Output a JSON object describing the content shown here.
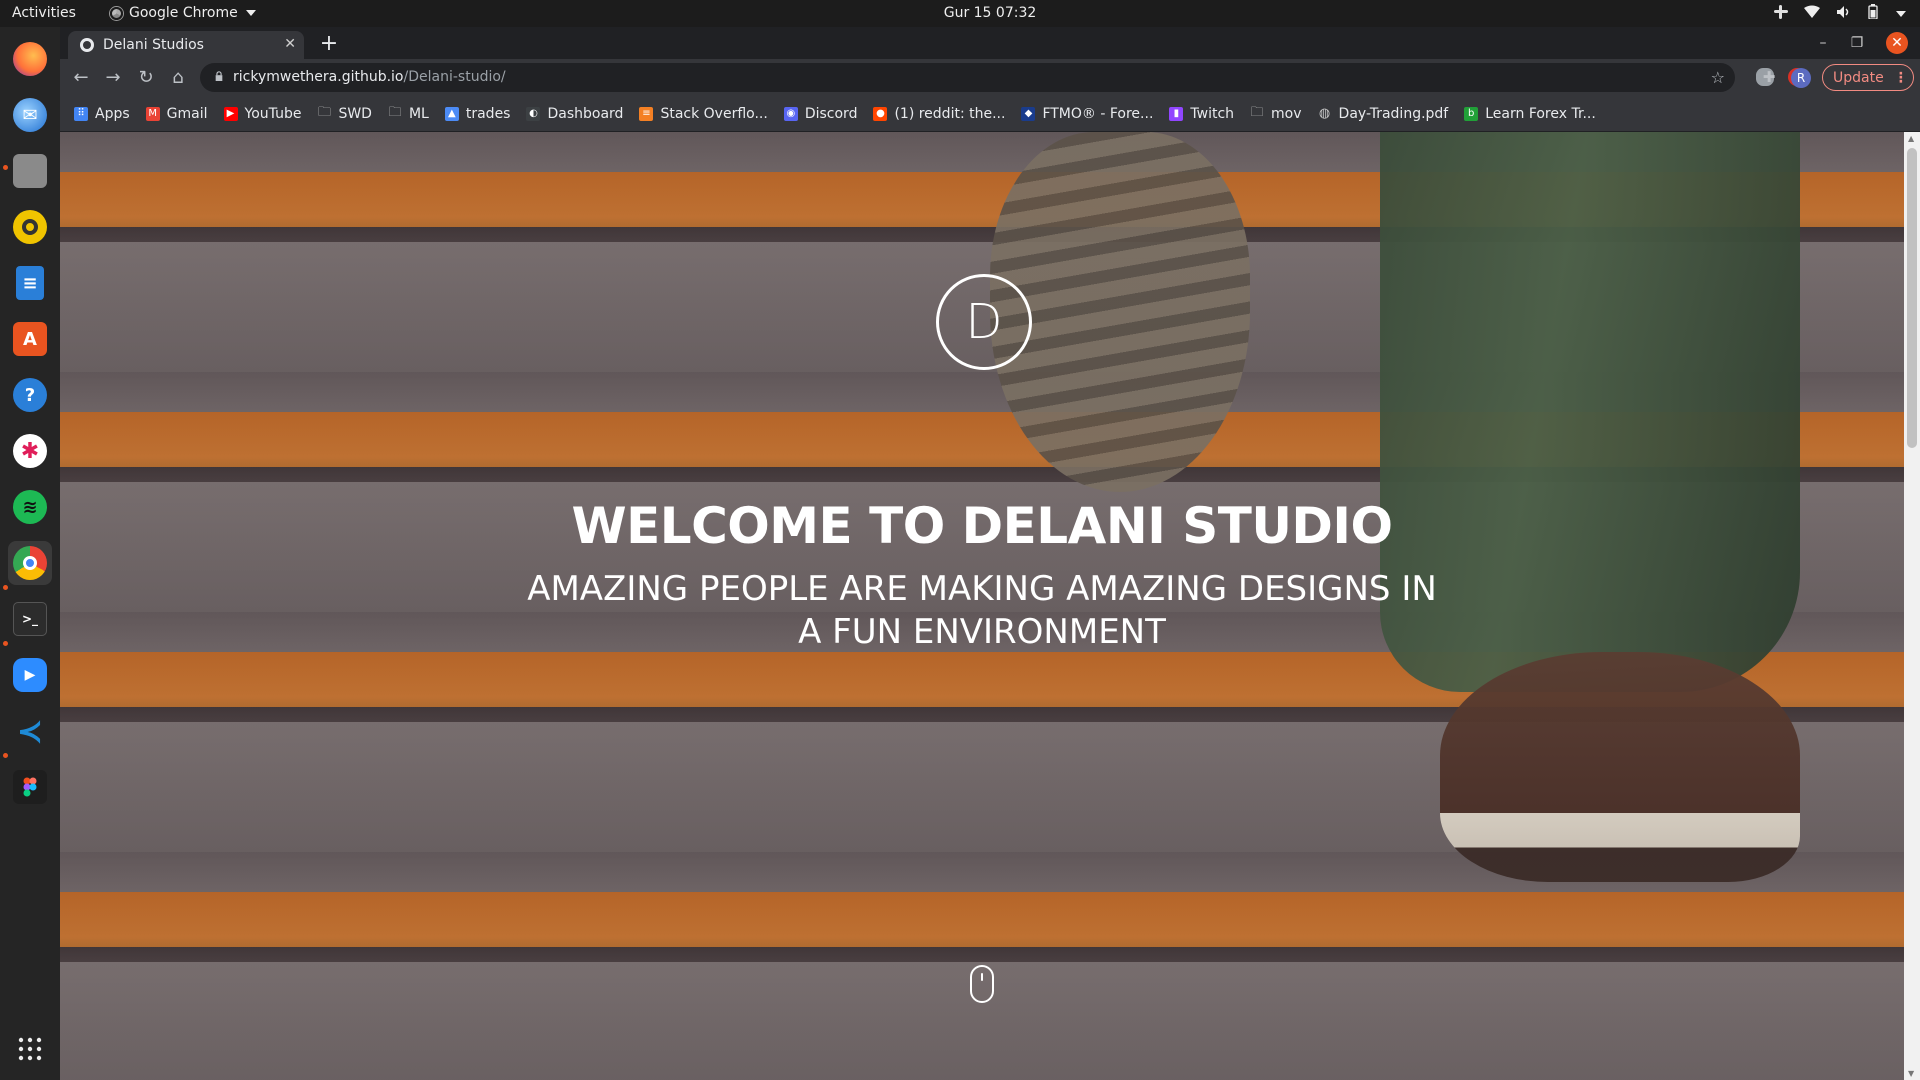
{
  "system_bar": {
    "activities": "Activities",
    "app_name": "Google Chrome",
    "clock": "Gur 15  07:32"
  },
  "dock": {
    "items": [
      {
        "name": "firefox-icon",
        "color": "#ff7139"
      },
      {
        "name": "thunderbird-icon",
        "color": "#1f6fd0"
      },
      {
        "name": "files-icon",
        "color": "#9e9e9e"
      },
      {
        "name": "rhythmbox-icon",
        "color": "#f0c400"
      },
      {
        "name": "writer-icon",
        "color": "#2a7fd8"
      },
      {
        "name": "software-center-icon",
        "color": "#e95420"
      },
      {
        "name": "help-icon",
        "color": "#2a7fd8"
      },
      {
        "name": "slack-icon",
        "color": "#ffffff"
      },
      {
        "name": "spotify-icon",
        "color": "#1db954"
      },
      {
        "name": "chrome-icon",
        "color": "#4285f4"
      },
      {
        "name": "terminal-icon",
        "color": "#2c2c2c"
      },
      {
        "name": "zoom-icon",
        "color": "#2d8cff"
      },
      {
        "name": "vscode-icon",
        "color": "#007acc"
      },
      {
        "name": "figma-icon",
        "color": "#a259ff"
      }
    ]
  },
  "browser": {
    "tab_title": "Delani Studios",
    "url_host": "rickymwethera.github.io",
    "url_path": "/Delani-studio/",
    "update_label": "Update",
    "profile_initial": "R",
    "bookmarks": [
      {
        "label": "Apps",
        "icon": "apps-grid-icon"
      },
      {
        "label": "Gmail",
        "icon": "gmail-icon"
      },
      {
        "label": "YouTube",
        "icon": "youtube-icon"
      },
      {
        "label": "SWD",
        "icon": "folder-icon"
      },
      {
        "label": "ML",
        "icon": "folder-icon"
      },
      {
        "label": "trades",
        "icon": "trades-icon"
      },
      {
        "label": "Dashboard",
        "icon": "dashboard-icon"
      },
      {
        "label": "Stack Overflo...",
        "icon": "stackoverflow-icon"
      },
      {
        "label": "Discord",
        "icon": "discord-icon"
      },
      {
        "label": "(1) reddit: the...",
        "icon": "reddit-icon"
      },
      {
        "label": "FTMO® - Fore...",
        "icon": "ftmo-icon"
      },
      {
        "label": "Twitch",
        "icon": "twitch-icon"
      },
      {
        "label": "mov",
        "icon": "folder-icon"
      },
      {
        "label": "Day-Trading.pdf",
        "icon": "globe-icon"
      },
      {
        "label": "Learn Forex Tr...",
        "icon": "babypips-icon"
      }
    ]
  },
  "page": {
    "logo_letter": "D",
    "title": "WELCOME TO DELANI STUDIO",
    "subtitle": "AMAZING PEOPLE ARE MAKING AMAZING DESIGNS IN A FUN ENVIRONMENT"
  }
}
